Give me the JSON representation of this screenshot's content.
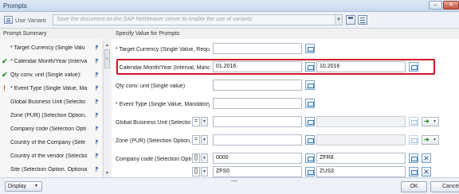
{
  "window": {
    "title": "Prompts"
  },
  "toolbar": {
    "use_variant_label": "Use Variant",
    "variant_placeholder": "Save the document on the SAP NetWeaver server to enable the use of variants"
  },
  "headers": {
    "summary": "Prompt Summary",
    "values": "Specify Value for Prompts"
  },
  "summary": [
    {
      "label": "* Target Currency (Single Valu",
      "status": "none"
    },
    {
      "label": "* Calendar Month/Year (Interva",
      "status": "done"
    },
    {
      "label": "Qty conv. unit (Single value):",
      "status": "done"
    },
    {
      "label": "* Event Type (Single Value, Ma",
      "status": "required"
    },
    {
      "label": "Global Business Unit (Selectio",
      "status": "none"
    },
    {
      "label": "Zone (PUR) (Selection Option,",
      "status": "none"
    },
    {
      "label": "Company code (Selection Opti",
      "status": "none"
    },
    {
      "label": "Country of the Company (Sele",
      "status": "none"
    },
    {
      "label": "Country of the vendor (Selectio",
      "status": "none"
    },
    {
      "label": "Site (Selection Option, Optiona",
      "status": "none"
    }
  ],
  "prompts": {
    "target_currency": {
      "label": "* Target Currency (Single Value, Requir",
      "value": ""
    },
    "calendar_month": {
      "label": "* Calendar Month/Year (Interval, Manda",
      "from": "01.2016",
      "to": "10.2016"
    },
    "qty_conv_unit": {
      "label": "Qty conv. unit (Single value)",
      "value": ""
    },
    "event_type": {
      "label": "* Event Type (Single Value, Mandatory)",
      "value": ""
    },
    "global_business_unit": {
      "label": "Global Business Unit (Selectio",
      "operator": "=",
      "value": ""
    },
    "zone": {
      "label": "Zone (PUR) (Selection Option,",
      "operator": "=",
      "value": ""
    },
    "company_code": {
      "label": "Company code (Selection Opti",
      "rows": [
        {
          "operator": "[]",
          "from": "0000",
          "to": "ZFR8"
        },
        {
          "operator": "[]",
          "from": "ZFS0",
          "to": "ZUS3"
        }
      ]
    }
  },
  "footer": {
    "display_label": "Display",
    "ok_label": "OK",
    "cancel_label": "Cancel"
  },
  "colors": {
    "highlight": "#d2152b",
    "ok_check": "#2f8f2f",
    "required_mark": "#d04a12"
  },
  "icons": {
    "status_done": "check-icon",
    "status_required": "exclamation-icon",
    "pin": "pin-icon",
    "value_help": "value-help-icon",
    "add": "add-icon",
    "remove": "remove-icon"
  }
}
